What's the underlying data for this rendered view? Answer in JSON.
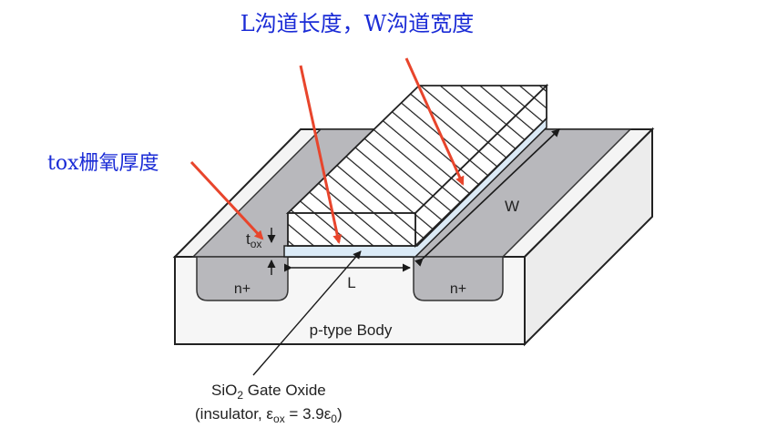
{
  "annotations": {
    "top_caption": "L沟道长度，W沟道宽度",
    "left_caption": "tox栅氧厚度"
  },
  "labels": {
    "source": "n+",
    "drain": "n+",
    "body": "p-type Body",
    "length": "L",
    "width": "W",
    "tox_main": "t",
    "tox_sub": "ox",
    "oxide_line1_a": "SiO",
    "oxide_line1_sub": "2",
    "oxide_line1_b": " Gate Oxide",
    "oxide_line2_a": "(insulator, ε",
    "oxide_line2_sub1": "ox",
    "oxide_line2_b": " = 3.9ε",
    "oxide_line2_sub2": "0",
    "oxide_line2_c": ")"
  },
  "colors": {
    "annotation_text": "#1a2bd6",
    "pointer_arrow": "#e8452c",
    "n_region": "#b8b8bc",
    "substrate": "#f4f4f4",
    "oxide": "#dbeaf6",
    "outline": "#222222"
  }
}
